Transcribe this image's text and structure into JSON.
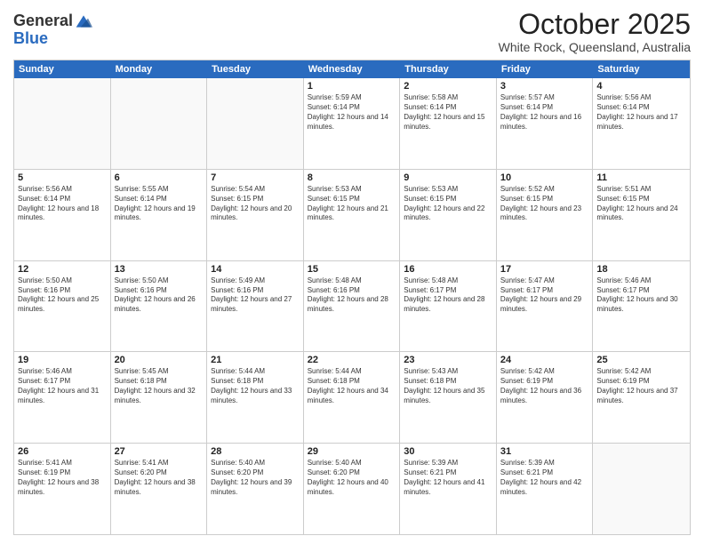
{
  "logo": {
    "general": "General",
    "blue": "Blue"
  },
  "header": {
    "month": "October 2025",
    "location": "White Rock, Queensland, Australia"
  },
  "days": [
    "Sunday",
    "Monday",
    "Tuesday",
    "Wednesday",
    "Thursday",
    "Friday",
    "Saturday"
  ],
  "weeks": [
    [
      {
        "day": "",
        "sunrise": "",
        "sunset": "",
        "daylight": ""
      },
      {
        "day": "",
        "sunrise": "",
        "sunset": "",
        "daylight": ""
      },
      {
        "day": "",
        "sunrise": "",
        "sunset": "",
        "daylight": ""
      },
      {
        "day": "1",
        "sunrise": "Sunrise: 5:59 AM",
        "sunset": "Sunset: 6:14 PM",
        "daylight": "Daylight: 12 hours and 14 minutes."
      },
      {
        "day": "2",
        "sunrise": "Sunrise: 5:58 AM",
        "sunset": "Sunset: 6:14 PM",
        "daylight": "Daylight: 12 hours and 15 minutes."
      },
      {
        "day": "3",
        "sunrise": "Sunrise: 5:57 AM",
        "sunset": "Sunset: 6:14 PM",
        "daylight": "Daylight: 12 hours and 16 minutes."
      },
      {
        "day": "4",
        "sunrise": "Sunrise: 5:56 AM",
        "sunset": "Sunset: 6:14 PM",
        "daylight": "Daylight: 12 hours and 17 minutes."
      }
    ],
    [
      {
        "day": "5",
        "sunrise": "Sunrise: 5:56 AM",
        "sunset": "Sunset: 6:14 PM",
        "daylight": "Daylight: 12 hours and 18 minutes."
      },
      {
        "day": "6",
        "sunrise": "Sunrise: 5:55 AM",
        "sunset": "Sunset: 6:14 PM",
        "daylight": "Daylight: 12 hours and 19 minutes."
      },
      {
        "day": "7",
        "sunrise": "Sunrise: 5:54 AM",
        "sunset": "Sunset: 6:15 PM",
        "daylight": "Daylight: 12 hours and 20 minutes."
      },
      {
        "day": "8",
        "sunrise": "Sunrise: 5:53 AM",
        "sunset": "Sunset: 6:15 PM",
        "daylight": "Daylight: 12 hours and 21 minutes."
      },
      {
        "day": "9",
        "sunrise": "Sunrise: 5:53 AM",
        "sunset": "Sunset: 6:15 PM",
        "daylight": "Daylight: 12 hours and 22 minutes."
      },
      {
        "day": "10",
        "sunrise": "Sunrise: 5:52 AM",
        "sunset": "Sunset: 6:15 PM",
        "daylight": "Daylight: 12 hours and 23 minutes."
      },
      {
        "day": "11",
        "sunrise": "Sunrise: 5:51 AM",
        "sunset": "Sunset: 6:15 PM",
        "daylight": "Daylight: 12 hours and 24 minutes."
      }
    ],
    [
      {
        "day": "12",
        "sunrise": "Sunrise: 5:50 AM",
        "sunset": "Sunset: 6:16 PM",
        "daylight": "Daylight: 12 hours and 25 minutes."
      },
      {
        "day": "13",
        "sunrise": "Sunrise: 5:50 AM",
        "sunset": "Sunset: 6:16 PM",
        "daylight": "Daylight: 12 hours and 26 minutes."
      },
      {
        "day": "14",
        "sunrise": "Sunrise: 5:49 AM",
        "sunset": "Sunset: 6:16 PM",
        "daylight": "Daylight: 12 hours and 27 minutes."
      },
      {
        "day": "15",
        "sunrise": "Sunrise: 5:48 AM",
        "sunset": "Sunset: 6:16 PM",
        "daylight": "Daylight: 12 hours and 28 minutes."
      },
      {
        "day": "16",
        "sunrise": "Sunrise: 5:48 AM",
        "sunset": "Sunset: 6:17 PM",
        "daylight": "Daylight: 12 hours and 28 minutes."
      },
      {
        "day": "17",
        "sunrise": "Sunrise: 5:47 AM",
        "sunset": "Sunset: 6:17 PM",
        "daylight": "Daylight: 12 hours and 29 minutes."
      },
      {
        "day": "18",
        "sunrise": "Sunrise: 5:46 AM",
        "sunset": "Sunset: 6:17 PM",
        "daylight": "Daylight: 12 hours and 30 minutes."
      }
    ],
    [
      {
        "day": "19",
        "sunrise": "Sunrise: 5:46 AM",
        "sunset": "Sunset: 6:17 PM",
        "daylight": "Daylight: 12 hours and 31 minutes."
      },
      {
        "day": "20",
        "sunrise": "Sunrise: 5:45 AM",
        "sunset": "Sunset: 6:18 PM",
        "daylight": "Daylight: 12 hours and 32 minutes."
      },
      {
        "day": "21",
        "sunrise": "Sunrise: 5:44 AM",
        "sunset": "Sunset: 6:18 PM",
        "daylight": "Daylight: 12 hours and 33 minutes."
      },
      {
        "day": "22",
        "sunrise": "Sunrise: 5:44 AM",
        "sunset": "Sunset: 6:18 PM",
        "daylight": "Daylight: 12 hours and 34 minutes."
      },
      {
        "day": "23",
        "sunrise": "Sunrise: 5:43 AM",
        "sunset": "Sunset: 6:18 PM",
        "daylight": "Daylight: 12 hours and 35 minutes."
      },
      {
        "day": "24",
        "sunrise": "Sunrise: 5:42 AM",
        "sunset": "Sunset: 6:19 PM",
        "daylight": "Daylight: 12 hours and 36 minutes."
      },
      {
        "day": "25",
        "sunrise": "Sunrise: 5:42 AM",
        "sunset": "Sunset: 6:19 PM",
        "daylight": "Daylight: 12 hours and 37 minutes."
      }
    ],
    [
      {
        "day": "26",
        "sunrise": "Sunrise: 5:41 AM",
        "sunset": "Sunset: 6:19 PM",
        "daylight": "Daylight: 12 hours and 38 minutes."
      },
      {
        "day": "27",
        "sunrise": "Sunrise: 5:41 AM",
        "sunset": "Sunset: 6:20 PM",
        "daylight": "Daylight: 12 hours and 38 minutes."
      },
      {
        "day": "28",
        "sunrise": "Sunrise: 5:40 AM",
        "sunset": "Sunset: 6:20 PM",
        "daylight": "Daylight: 12 hours and 39 minutes."
      },
      {
        "day": "29",
        "sunrise": "Sunrise: 5:40 AM",
        "sunset": "Sunset: 6:20 PM",
        "daylight": "Daylight: 12 hours and 40 minutes."
      },
      {
        "day": "30",
        "sunrise": "Sunrise: 5:39 AM",
        "sunset": "Sunset: 6:21 PM",
        "daylight": "Daylight: 12 hours and 41 minutes."
      },
      {
        "day": "31",
        "sunrise": "Sunrise: 5:39 AM",
        "sunset": "Sunset: 6:21 PM",
        "daylight": "Daylight: 12 hours and 42 minutes."
      },
      {
        "day": "",
        "sunrise": "",
        "sunset": "",
        "daylight": ""
      }
    ]
  ]
}
